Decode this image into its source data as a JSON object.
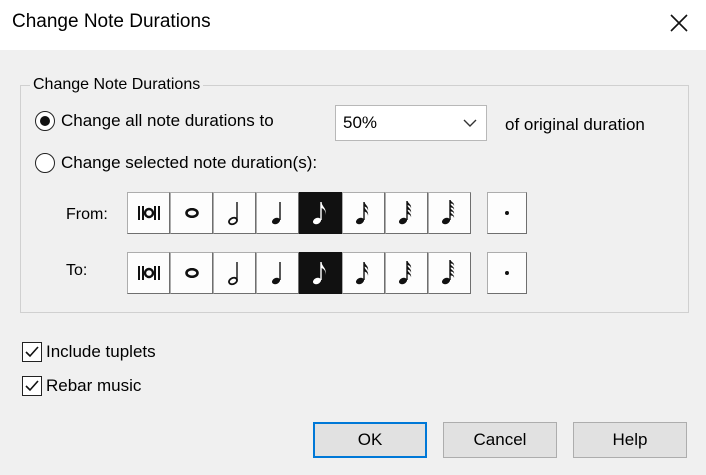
{
  "window": {
    "title": "Change Note Durations"
  },
  "group": {
    "label": "Change Note Durations"
  },
  "option_all": {
    "label": "Change all note durations to",
    "selected": true
  },
  "percent_select": {
    "value": "50%"
  },
  "suffix": "of original duration",
  "option_selected": {
    "label": "Change selected note duration(s):",
    "selected": false
  },
  "from_row": {
    "label": "From:",
    "selected_index": 4,
    "notes": [
      "breve-icon",
      "whole-note-icon",
      "half-note-icon",
      "quarter-note-icon",
      "eighth-note-icon",
      "sixteenth-note-icon",
      "thirty-second-note-icon",
      "sixty-fourth-note-icon"
    ],
    "dot": "augmentation-dot-icon"
  },
  "to_row": {
    "label": "To:",
    "selected_index": 4,
    "notes": [
      "breve-icon",
      "whole-note-icon",
      "half-note-icon",
      "quarter-note-icon",
      "eighth-note-icon",
      "sixteenth-note-icon",
      "thirty-second-note-icon",
      "sixty-fourth-note-icon"
    ],
    "dot": "augmentation-dot-icon"
  },
  "include_tuplets": {
    "label": "Include tuplets",
    "checked": true
  },
  "rebar_music": {
    "label": "Rebar music",
    "checked": true
  },
  "buttons": {
    "ok": "OK",
    "cancel": "Cancel",
    "help": "Help"
  },
  "colors": {
    "accent": "#0078d7",
    "dialog_bg": "#f0f0f0",
    "selected_button": "#111111"
  }
}
